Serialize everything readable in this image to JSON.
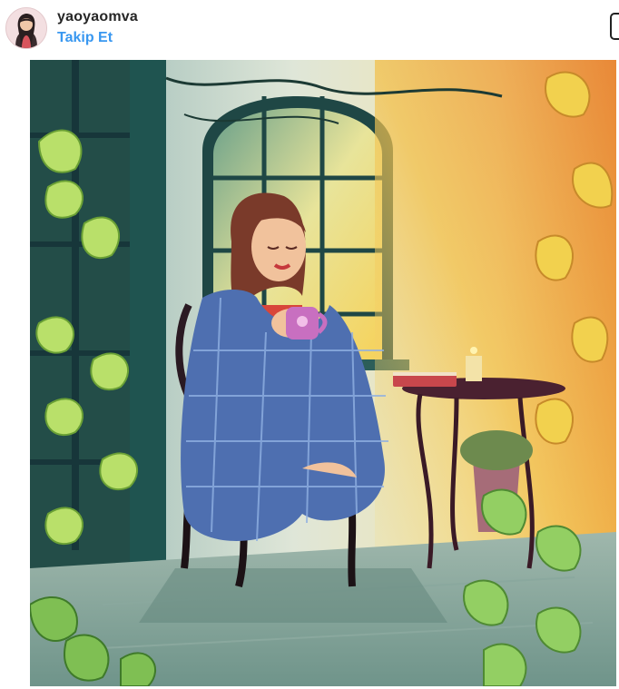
{
  "post": {
    "username": "yaoyaomva",
    "follow_label": "Takip Et"
  },
  "icons": {
    "avatar": "profile-avatar",
    "more": "options-frame-icon"
  },
  "colors": {
    "follow": "#3897f0",
    "username": "#262626"
  }
}
